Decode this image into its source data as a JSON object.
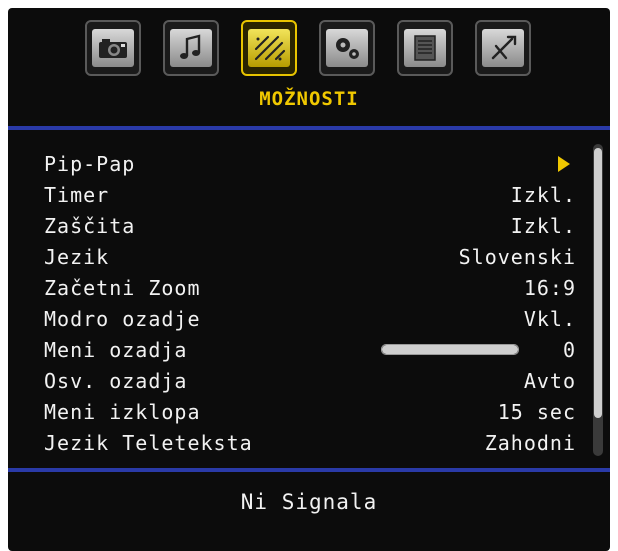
{
  "tabs": [
    {
      "icon": "camera-icon"
    },
    {
      "icon": "music-note-icon"
    },
    {
      "icon": "options-wand-icon",
      "active": true
    },
    {
      "icon": "gear-icon"
    },
    {
      "icon": "list-document-icon"
    },
    {
      "icon": "tools-icon"
    }
  ],
  "menu": {
    "title": "MOŽNOSTI",
    "items": [
      {
        "label": "Pip-Pap",
        "value": "",
        "has_arrow": true
      },
      {
        "label": "Timer",
        "value": "Izkl."
      },
      {
        "label": "Zaščita",
        "value": "Izkl."
      },
      {
        "label": "Jezik",
        "value": "Slovenski"
      },
      {
        "label": "Začetni Zoom",
        "value": "16:9"
      },
      {
        "label": "Modro ozadje",
        "value": "Vkl."
      },
      {
        "label": "Meni ozadja",
        "value": "0",
        "slider_level": 1.0
      },
      {
        "label": "Osv. ozadja",
        "value": "Avto"
      },
      {
        "label": "Meni izklopa",
        "value": "15 sec"
      },
      {
        "label": "Jezik Teleteksta",
        "value": "Zahodni"
      }
    ]
  },
  "status": {
    "text": "Ni Signala"
  },
  "colors": {
    "accent": "#f0c800",
    "divider": "#2a3aa8",
    "background": "#0c0c0c",
    "text": "#f2f2f2"
  }
}
